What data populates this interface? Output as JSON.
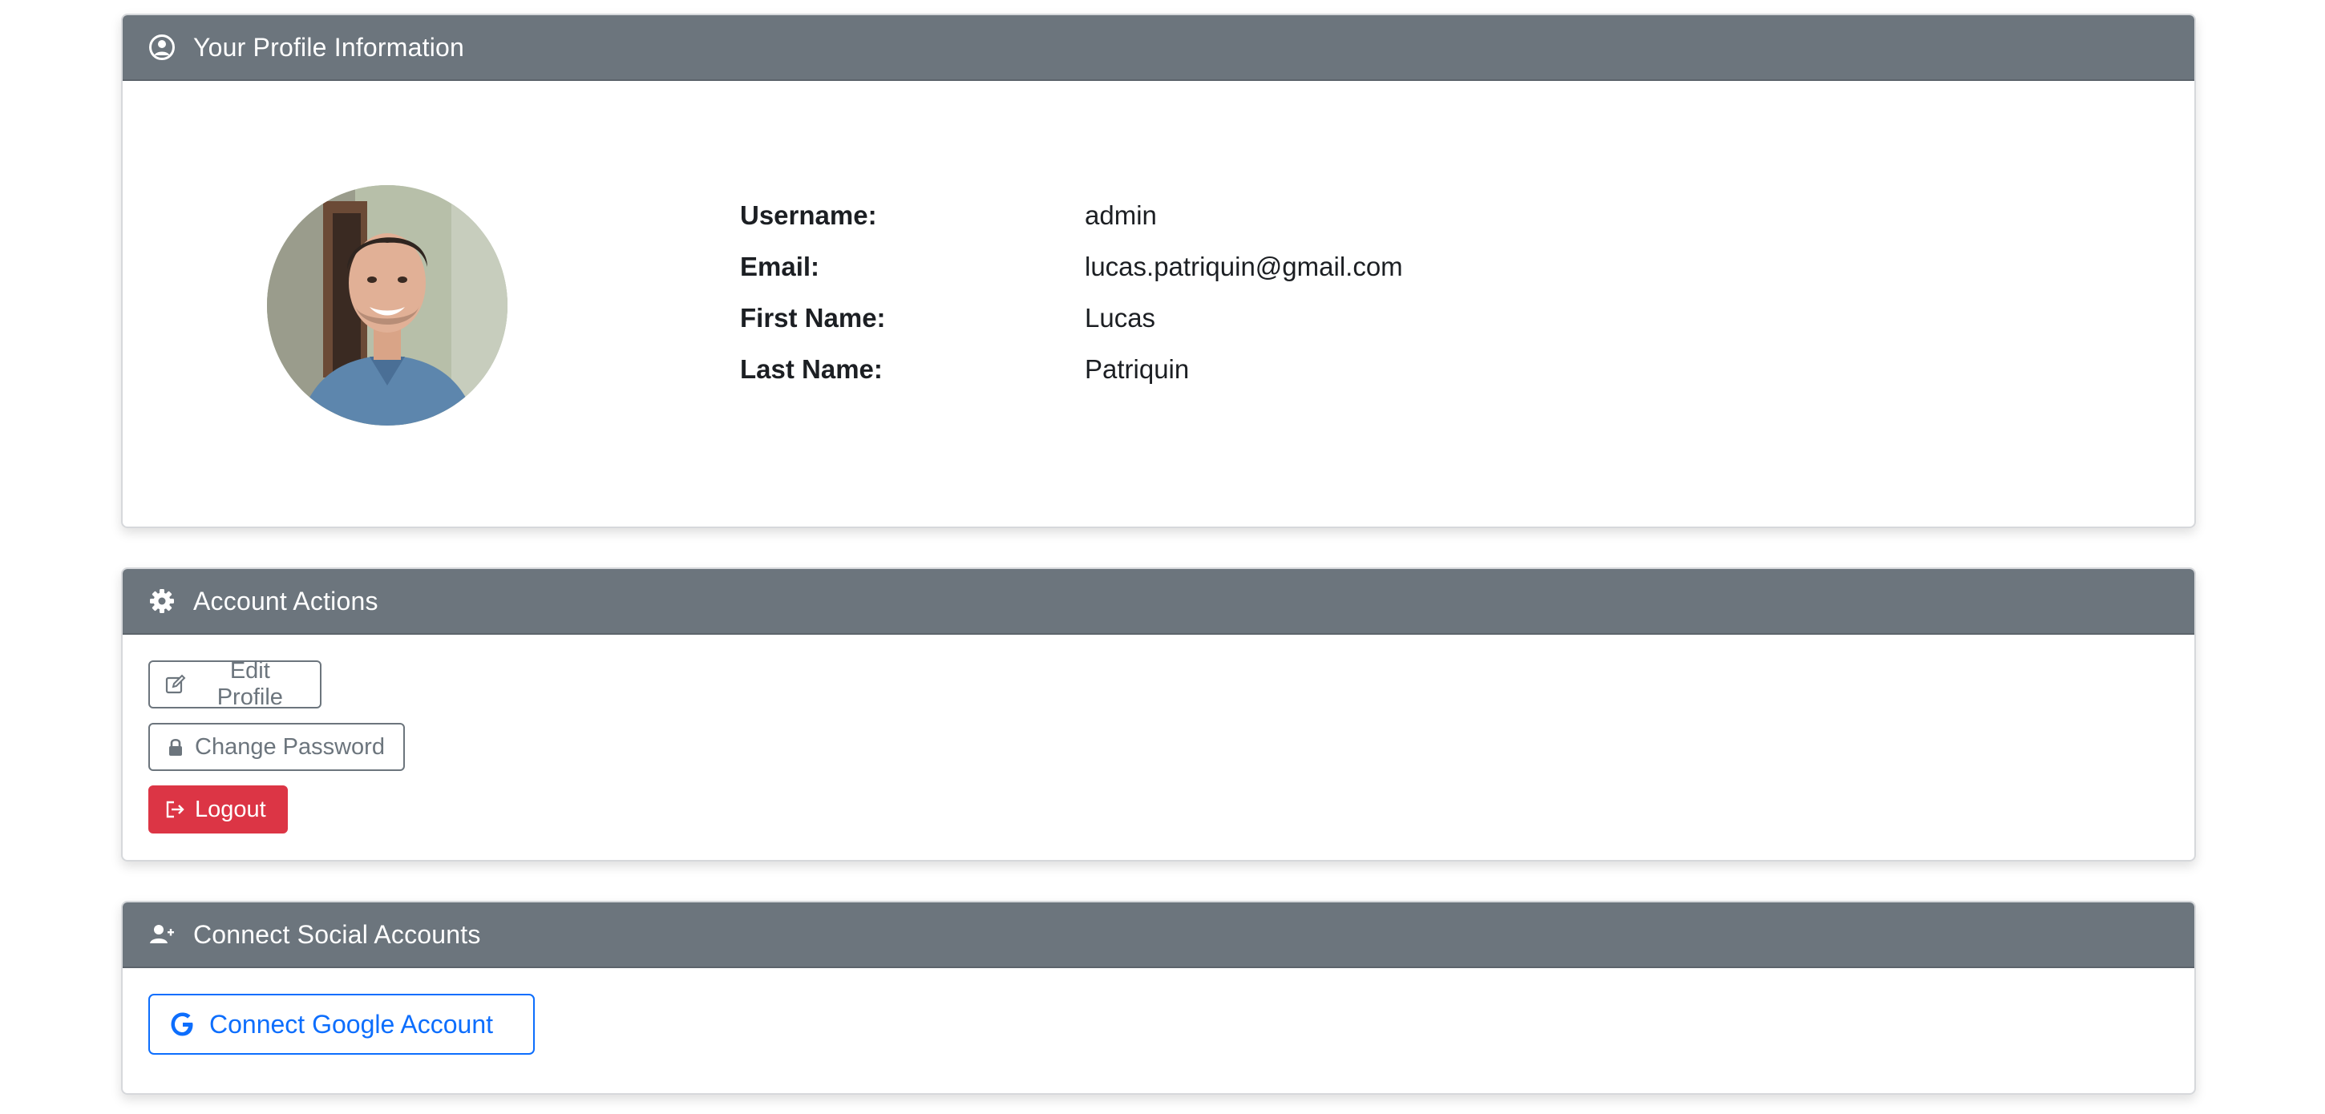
{
  "profile_card": {
    "title": "Your Profile Information",
    "icon": "user-circle-icon",
    "fields": [
      {
        "label": "Username:",
        "value": "admin"
      },
      {
        "label": "Email:",
        "value": "lucas.patriquin@gmail.com"
      },
      {
        "label": "First Name:",
        "value": "Lucas"
      },
      {
        "label": "Last Name:",
        "value": "Patriquin"
      }
    ],
    "avatar_icon": "profile-photo"
  },
  "actions_card": {
    "title": "Account Actions",
    "icon": "gear-icon",
    "buttons": [
      {
        "label": "Edit Profile",
        "icon": "edit-icon"
      },
      {
        "label": "Change Password",
        "icon": "lock-icon"
      },
      {
        "label": "Logout",
        "icon": "logout-icon"
      }
    ]
  },
  "social_card": {
    "title": "Connect Social Accounts",
    "icon": "user-plus-icon",
    "google_button": {
      "label": "Connect Google Account",
      "icon": "google-icon"
    }
  },
  "colors": {
    "header_bg": "#6c757d",
    "danger": "#dc3545",
    "primary": "#0d6efd",
    "secondary": "#6c757d"
  }
}
